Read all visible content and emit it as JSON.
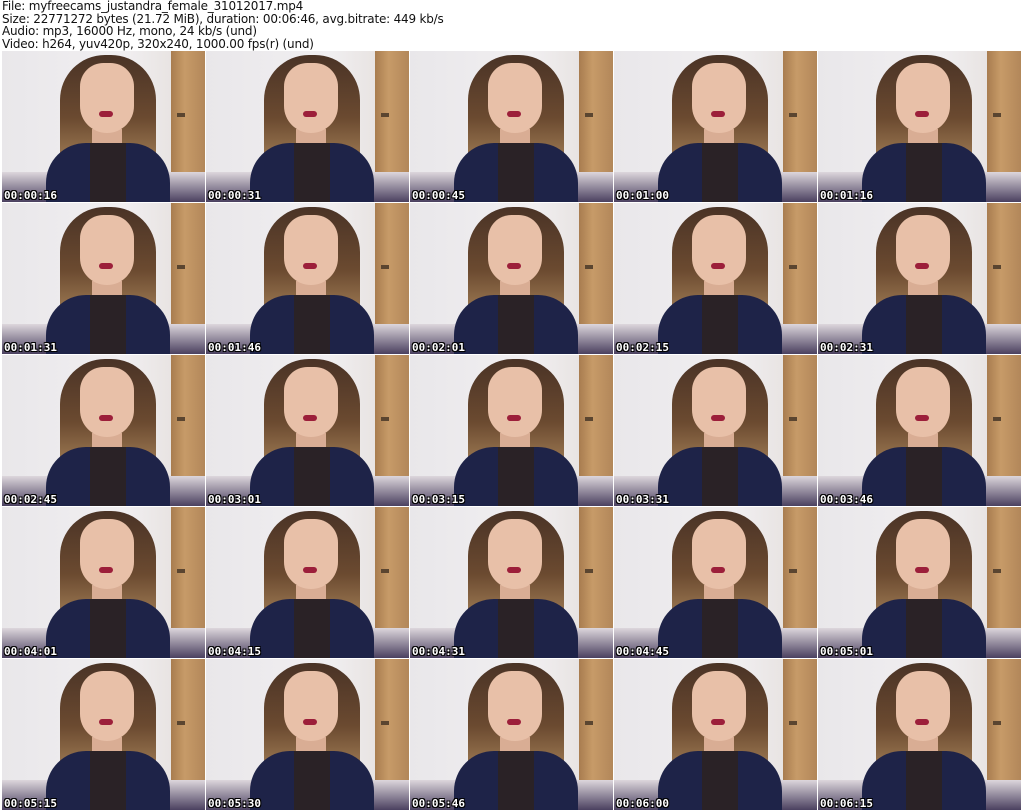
{
  "header": {
    "file": "File: myfreecams_justandra_female_31012017.mp4",
    "size": "Size: 22771272 bytes (21.72 MiB), duration: 00:06:46, avg.bitrate: 449 kb/s",
    "audio": "Audio: mp3, 16000 Hz, mono, 24 kb/s (und)",
    "video": "Video: h264, yuv420p, 320x240, 1000.00 fps(r) (und)"
  },
  "thumbnails": [
    "00:00:16",
    "00:00:31",
    "00:00:45",
    "00:01:00",
    "00:01:16",
    "00:01:31",
    "00:01:46",
    "00:02:01",
    "00:02:15",
    "00:02:31",
    "00:02:45",
    "00:03:01",
    "00:03:15",
    "00:03:31",
    "00:03:46",
    "00:04:01",
    "00:04:15",
    "00:04:31",
    "00:04:45",
    "00:05:01",
    "00:05:15",
    "00:05:30",
    "00:05:46",
    "00:06:00",
    "00:06:15"
  ]
}
